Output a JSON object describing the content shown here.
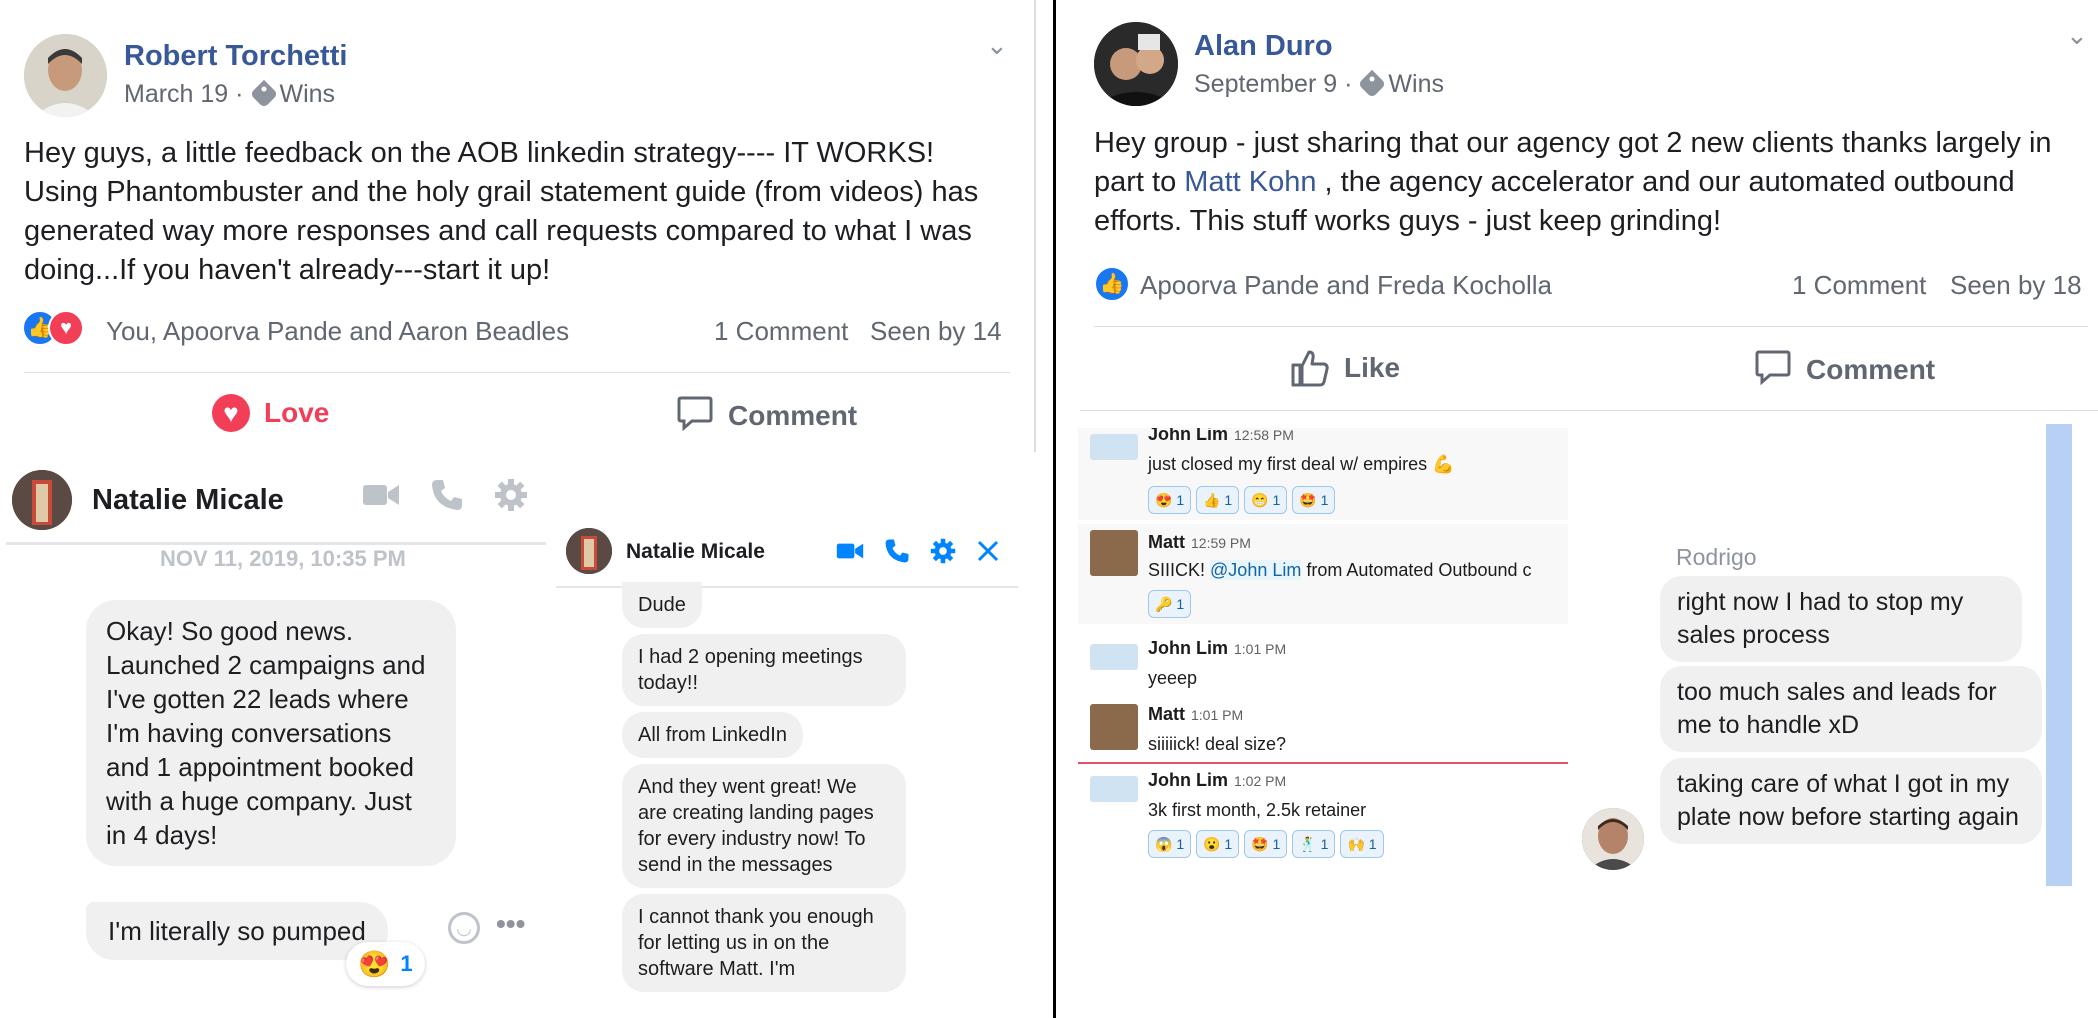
{
  "post1": {
    "author": "Robert Torchetti",
    "date": "March 19",
    "separator": "·",
    "group_tag": "Wins",
    "body": "Hey guys, a little feedback on the AOB linkedin strategy---- IT WORKS! Using Phantombuster and the holy grail statement guide (from videos) has generated way more responses and call requests compared to what I was doing...If you haven't already---start it up!",
    "reactions_text": "You, Apoorva Pande and Aaron Beadles",
    "comments": "1 Comment",
    "seen": "Seen by 14",
    "love_label": "Love",
    "comment_label": "Comment"
  },
  "post2": {
    "author": "Alan Duro",
    "date": "September 9",
    "separator": "·",
    "group_tag": "Wins",
    "body_before": "Hey group - just sharing that our agency got 2 new clients thanks largely in part to",
    "body_link": "Matt Kohn",
    "body_after": ", the agency accelerator and our automated outbound efforts. This stuff works guys - just keep grinding!",
    "reactions_text": "Apoorva Pande and Freda Kocholla",
    "comments": "1 Comment",
    "seen": "Seen by 18",
    "like_label": "Like",
    "comment_label": "Comment"
  },
  "chat1": {
    "name": "Natalie Micale",
    "timestamp": "NOV 11, 2019, 10:35 PM",
    "message": "Okay! So good news. Launched 2 campaigns and I've gotten 22 leads where I'm having conversations and 1 appointment booked with a huge company. Just in 4 days!",
    "message2": "I'm literally so pumped",
    "reaction_count": "1"
  },
  "chat2": {
    "name": "Natalie Micale",
    "messages": [
      "Dude",
      "I had 2 opening meetings today!!",
      "All from LinkedIn",
      "And they went great! We are creating landing pages for every industry now! To send in the messages",
      "I cannot thank you enough for letting us in on the software Matt. I'm"
    ]
  },
  "slack": {
    "messages": [
      {
        "name": "John Lim",
        "time": "12:58 PM",
        "text": "just closed my first deal w/ empires 💪",
        "reactions": [
          "😍 1",
          "👍 1",
          "😁 1",
          "🤩 1"
        ]
      },
      {
        "name": "Matt",
        "time": "12:59 PM",
        "text_before": "SIIICK!",
        "mention": "@John Lim",
        "text_after": "from Automated Outbound c",
        "reactions": [
          "🔑 1"
        ]
      },
      {
        "name": "John Lim",
        "time": "1:01 PM",
        "text": "yeeep"
      },
      {
        "name": "Matt",
        "time": "1:01 PM",
        "text": "siiiiick! deal size?"
      },
      {
        "name": "John Lim",
        "time": "1:02 PM",
        "text": "3k first month, 2.5k retainer",
        "reactions": [
          "😱 1",
          "😮 1",
          "🤩 1",
          "🕺 1",
          "🙌 1"
        ]
      }
    ]
  },
  "chat3": {
    "name": "Rodrigo",
    "messages": [
      "right now I had to stop my sales process",
      "too much sales and leads for me to handle xD",
      "taking care of what I got in my plate now before starting again"
    ]
  },
  "colors": {
    "facebook_blue": "#385898",
    "messenger_blue": "#0084ff",
    "love_red": "#f33e58",
    "slack_link": "#1264a3"
  }
}
